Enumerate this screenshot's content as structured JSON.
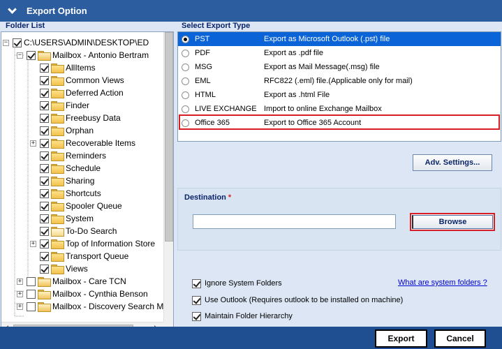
{
  "window": {
    "title": "Export Option",
    "app_icon": "chevron-down-icon"
  },
  "folder_list": {
    "header": "Folder List",
    "items": [
      {
        "label": "C:\\USERS\\ADMIN\\DESKTOP\\ED",
        "level": 0,
        "checked": true,
        "expander": "minus"
      },
      {
        "label": "Mailbox - Antonio Bertram",
        "level": 1,
        "checked": true,
        "expander": "minus",
        "icon": "mailbox-folder-icon"
      },
      {
        "label": "AllItems",
        "level": 2,
        "checked": true
      },
      {
        "label": "Common Views",
        "level": 2,
        "checked": true
      },
      {
        "label": "Deferred Action",
        "level": 2,
        "checked": true
      },
      {
        "label": "Finder",
        "level": 2,
        "checked": true
      },
      {
        "label": "Freebusy Data",
        "level": 2,
        "checked": true
      },
      {
        "label": "Orphan",
        "level": 2,
        "checked": true
      },
      {
        "label": "Recoverable Items",
        "level": 2,
        "checked": true,
        "expander": "plus"
      },
      {
        "label": "Reminders",
        "level": 2,
        "checked": true
      },
      {
        "label": "Schedule",
        "level": 2,
        "checked": true
      },
      {
        "label": "Sharing",
        "level": 2,
        "checked": true
      },
      {
        "label": "Shortcuts",
        "level": 2,
        "checked": true
      },
      {
        "label": "Spooler Queue",
        "level": 2,
        "checked": true
      },
      {
        "label": "System",
        "level": 2,
        "checked": true
      },
      {
        "label": "To-Do Search",
        "level": 2,
        "checked": true,
        "icon": "todo-folder-icon"
      },
      {
        "label": "Top of Information Store",
        "level": 2,
        "checked": true,
        "expander": "plus"
      },
      {
        "label": "Transport Queue",
        "level": 2,
        "checked": true
      },
      {
        "label": "Views",
        "level": 2,
        "checked": true
      },
      {
        "label": "Mailbox - Care TCN",
        "level": 1,
        "checked": false,
        "expander": "plus",
        "icon": "mailbox-folder-icon"
      },
      {
        "label": "Mailbox - Cynthia Benson",
        "level": 1,
        "checked": false,
        "expander": "plus",
        "icon": "mailbox-folder-icon"
      },
      {
        "label": "Mailbox - Discovery Search M",
        "level": 1,
        "checked": false,
        "expander": "plus",
        "icon": "mailbox-folder-icon"
      }
    ]
  },
  "export_type": {
    "header": "Select Export Type",
    "options": [
      {
        "name": "PST",
        "desc": "Export as Microsoft Outlook (.pst) file",
        "selected": true
      },
      {
        "name": "PDF",
        "desc": "Export as .pdf file",
        "selected": false
      },
      {
        "name": "MSG",
        "desc": "Export as Mail Message(.msg) file",
        "selected": false
      },
      {
        "name": "EML",
        "desc": "RFC822 (.eml) file.(Applicable only for mail)",
        "selected": false
      },
      {
        "name": "HTML",
        "desc": "Export as .html File",
        "selected": false
      },
      {
        "name": "LIVE EXCHANGE",
        "desc": "Import to online Exchange Mailbox",
        "selected": false,
        "highlighted": true
      },
      {
        "name": "Office 365",
        "desc": "Export to Office 365 Account",
        "selected": false
      }
    ],
    "highlight_color": "#d91d24",
    "selected_color": "#0a64d8"
  },
  "adv_settings": {
    "label": "Adv. Settings..."
  },
  "destination": {
    "label": "Destination",
    "required_mark": "*",
    "value": "",
    "browse_label": "Browse"
  },
  "options": {
    "ignore_system": {
      "label": "Ignore System Folders",
      "checked": true
    },
    "use_outlook": {
      "label": "Use Outlook (Requires outlook to be installed on machine)",
      "checked": true
    },
    "maintain_hierarchy": {
      "label": "Maintain Folder Hierarchy",
      "checked": true
    },
    "system_folders_link": "What are system folders ?"
  },
  "footer": {
    "export_label": "Export",
    "cancel_label": "Cancel"
  }
}
